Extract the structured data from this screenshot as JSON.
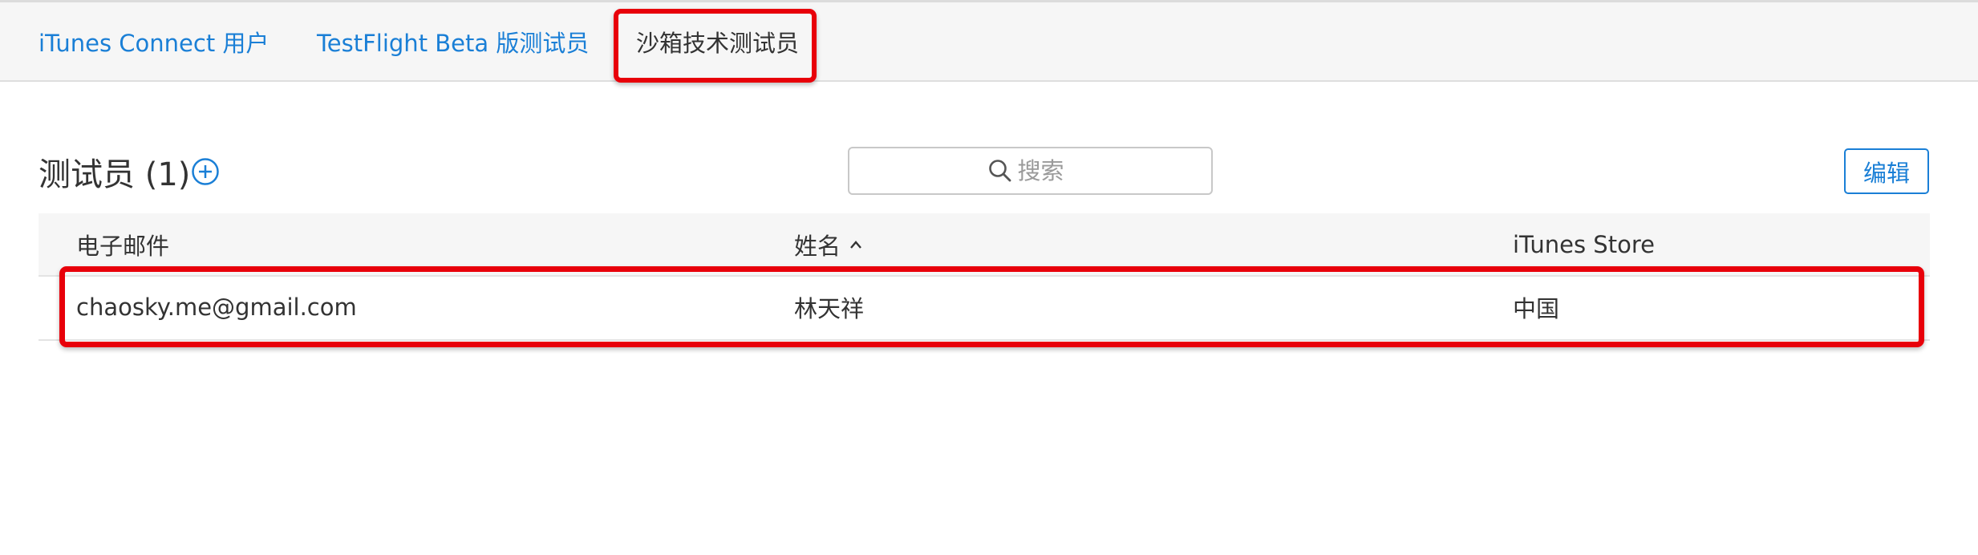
{
  "tabs": [
    {
      "label": "iTunes Connect 用户",
      "active": false
    },
    {
      "label": "TestFlight Beta 版测试员",
      "active": false
    },
    {
      "label": "沙箱技术测试员",
      "active": true
    }
  ],
  "section": {
    "title": "测试员 (1)",
    "add_icon": "plus-circle-icon",
    "search_placeholder": "搜索",
    "search_icon": "magnifier-icon",
    "edit_label": "编辑"
  },
  "table": {
    "columns": [
      "电子邮件",
      "姓名",
      "iTunes Store"
    ],
    "sorted_column": "姓名",
    "sort_direction": "ascending",
    "rows": [
      {
        "email": "chaosky.me@gmail.com",
        "name": "林天祥",
        "store": "中国"
      }
    ]
  },
  "colors": {
    "link": "#1a7fd6",
    "highlight": "#e8000a",
    "tabbar_bg": "#f6f6f6"
  }
}
